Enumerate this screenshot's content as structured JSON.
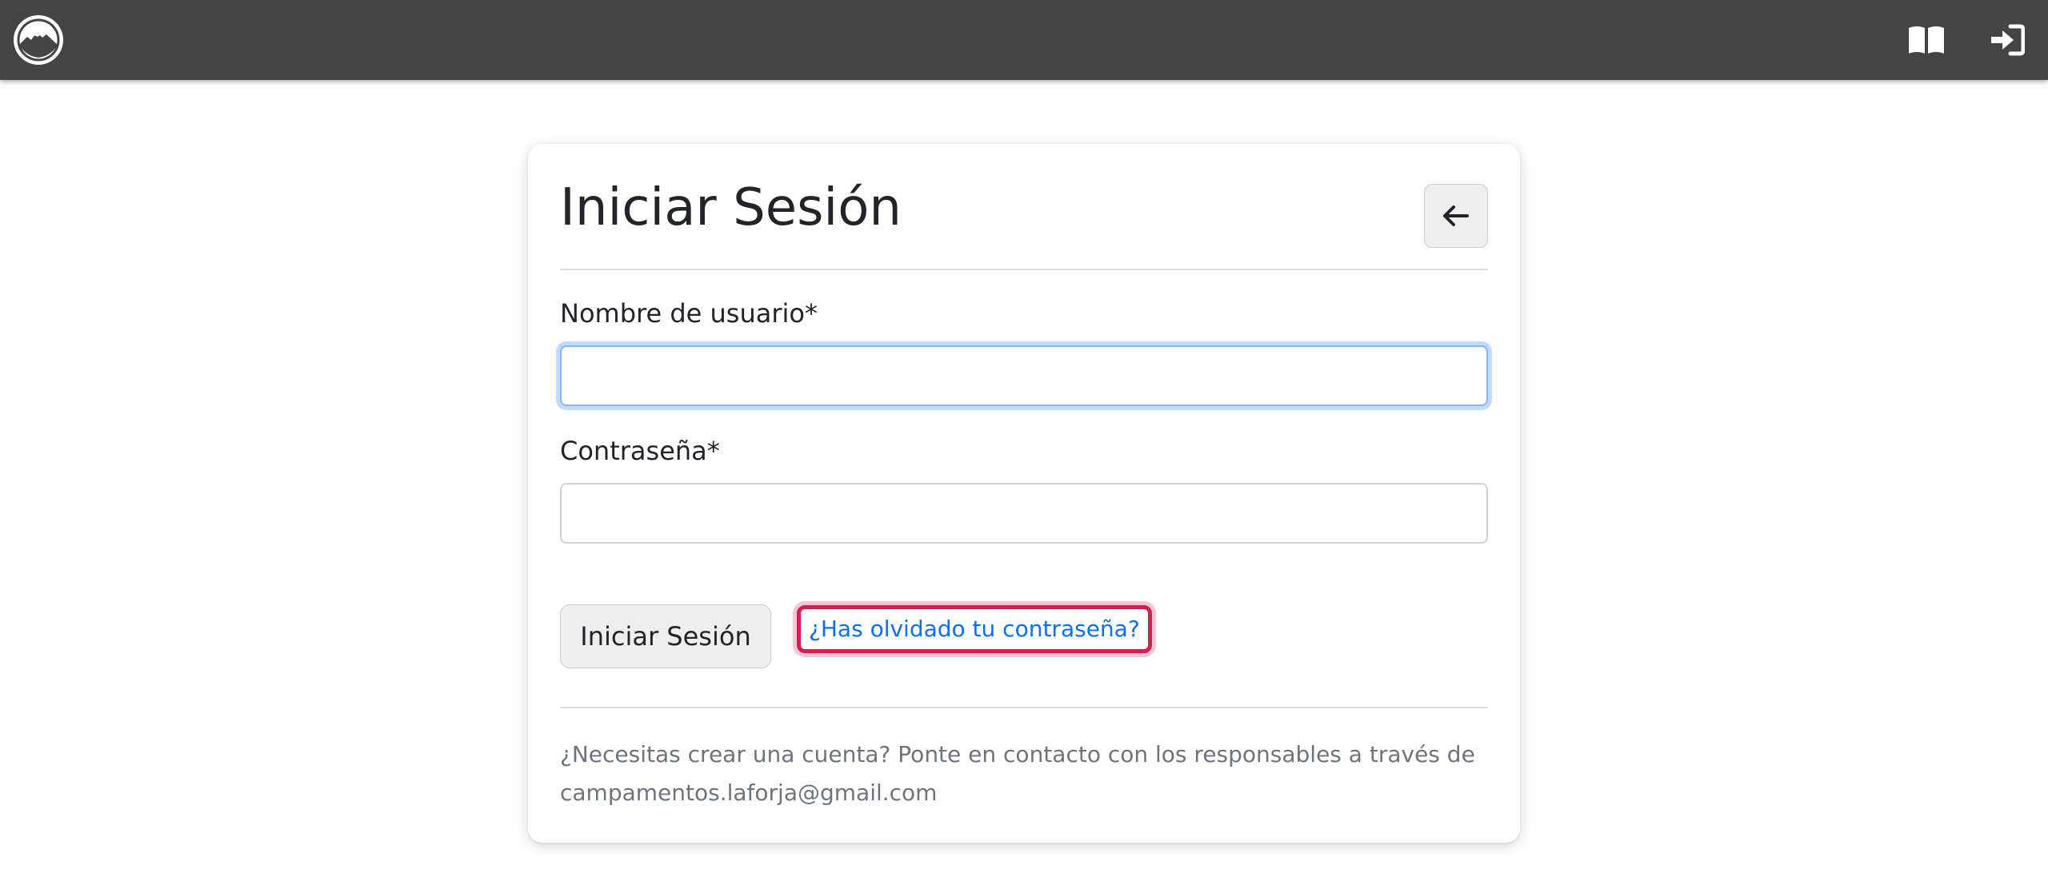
{
  "topbar": {
    "logo_icon": "mountain-logo-icon",
    "docs_icon": "open-book-icon",
    "login_icon": "sign-in-icon",
    "background": "#444444"
  },
  "login_card": {
    "title": "Iniciar Sesión",
    "back_icon": "arrow-left-icon",
    "username": {
      "label": "Nombre de usuario*",
      "value": "",
      "placeholder": ""
    },
    "password": {
      "label": "Contraseña*",
      "value": "",
      "placeholder": ""
    },
    "submit_label": "Iniciar Sesión",
    "forgot_password_label": "¿Has olvidado tu contraseña?",
    "footer_line1": "¿Necesitas crear una cuenta? Ponte en contacto con los responsables a través de",
    "footer_line2": "campamentos.laforja@gmail.com"
  },
  "colors": {
    "link": "#0d6efd",
    "highlight_border": "#d11f4f",
    "focus_ring": "#86b7fe",
    "muted_text": "#6c757d"
  }
}
